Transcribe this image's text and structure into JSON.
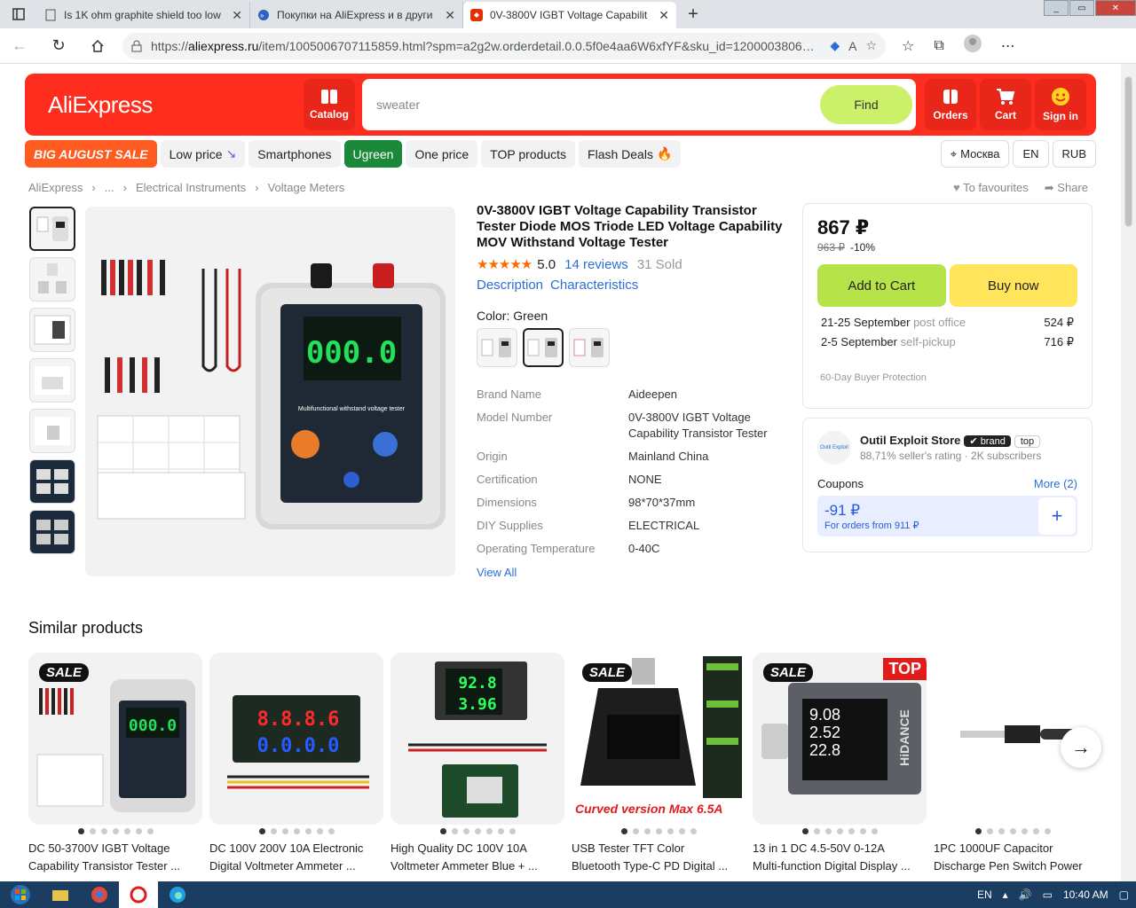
{
  "browser": {
    "tabs": [
      {
        "title": "Is 1K ohm graphite shield too low"
      },
      {
        "title": "Покупки на AliExpress и в други"
      },
      {
        "title": "0V-3800V IGBT Voltage Capabilit"
      }
    ],
    "url_prefix": "https://",
    "url_domain": "aliexpress.ru",
    "url_rest": "/item/1005006707115859.html?spm=a2g2w.orderdetail.0.0.5f0e4aa6W6xfYF&sku_id=1200003806191598..."
  },
  "header": {
    "logo": "AliExpress",
    "catalog": "Catalog",
    "search_value": "sweater",
    "find": "Find",
    "orders": "Orders",
    "cart": "Cart",
    "signin": "Sign in"
  },
  "categories": [
    "BIG AUGUST SALE",
    "Low price",
    "Smartphones",
    "Ugreen",
    "One price",
    "TOP products",
    "Flash Deals"
  ],
  "location": {
    "city": "Москва",
    "lang": "EN",
    "currency": "RUB"
  },
  "breadcrumbs": [
    "AliExpress",
    "...",
    "Electrical Instruments",
    "Voltage Meters"
  ],
  "actions": {
    "favourites": "To favourites",
    "share": "Share"
  },
  "product": {
    "title": "0V-3800V IGBT Voltage Capability Transistor Tester Diode MOS Triode LED Voltage Capability MOV Withstand Voltage Tester",
    "rating": "5.0",
    "reviews": "14 reviews",
    "sold": "31 Sold",
    "tab_description": "Description",
    "tab_characteristics": "Characteristics",
    "color_label": "Color: Green",
    "view_all": "View All",
    "display_value": "000.0",
    "panel_text": "Multifunctional withstand voltage tester",
    "specs": [
      {
        "k": "Brand Name",
        "v": "Aideepen"
      },
      {
        "k": "Model Number",
        "v": "0V-3800V IGBT Voltage Capability Transistor Tester"
      },
      {
        "k": "Origin",
        "v": "Mainland China"
      },
      {
        "k": "Certification",
        "v": "NONE"
      },
      {
        "k": "Dimensions",
        "v": "98*70*37mm"
      },
      {
        "k": "DIY Supplies",
        "v": "ELECTRICAL"
      },
      {
        "k": "Operating Temperature",
        "v": "0-40C"
      }
    ]
  },
  "buy": {
    "price": "867 ₽",
    "old_price": "963 ₽",
    "discount": "-10%",
    "add_to_cart": "Add to Cart",
    "buy_now": "Buy now",
    "shipping": [
      {
        "date": "21-25 September",
        "method": "post office",
        "cost": "524 ₽"
      },
      {
        "date": "2-5 September",
        "method": "self-pickup",
        "cost": "716 ₽"
      }
    ],
    "protection": "60-Day Buyer Protection"
  },
  "store": {
    "name": "Outil Exploit Store",
    "logo_text": "Outil Exploit",
    "badge_brand": "brand",
    "badge_top": "top",
    "rating": "88,71% seller's rating",
    "subscribers": "2K subscribers",
    "coupons": "Coupons",
    "more": "More (2)",
    "coupon_amount": "-91 ₽",
    "coupon_sub": "For orders from 911 ₽"
  },
  "similar": {
    "title": "Similar products",
    "sale_label": "SALE",
    "top_label": "TOP",
    "curved_label": "Curved version Max 6.5A",
    "meter_red": "8.8.8.6",
    "meter_blue": "0.0.0.0",
    "meter_green1": "92.8",
    "meter_green2": "3.96",
    "brand_hidance": "HiDANCE",
    "readout": [
      "9.08",
      "2.52",
      "22.8"
    ],
    "items": [
      {
        "line1": "DC 50-3700V IGBT Voltage",
        "line2": "Capability Transistor Tester ..."
      },
      {
        "line1": "DC 100V 200V 10A Electronic",
        "line2": "Digital Voltmeter Ammeter ..."
      },
      {
        "line1": "High Quality DC 100V 10A",
        "line2": "Voltmeter Ammeter Blue + ..."
      },
      {
        "line1": "USB Tester TFT Color",
        "line2": "Bluetooth Type-C PD Digital ..."
      },
      {
        "line1": "13 in 1 DC 4.5-50V 0-12A",
        "line2": "Multi-function Digital Display ..."
      },
      {
        "line1": "1PC 1000UF Capacitor",
        "line2": "Discharge Pen Switch Power"
      }
    ]
  },
  "taskbar": {
    "lang": "EN",
    "time": "10:40 AM"
  }
}
